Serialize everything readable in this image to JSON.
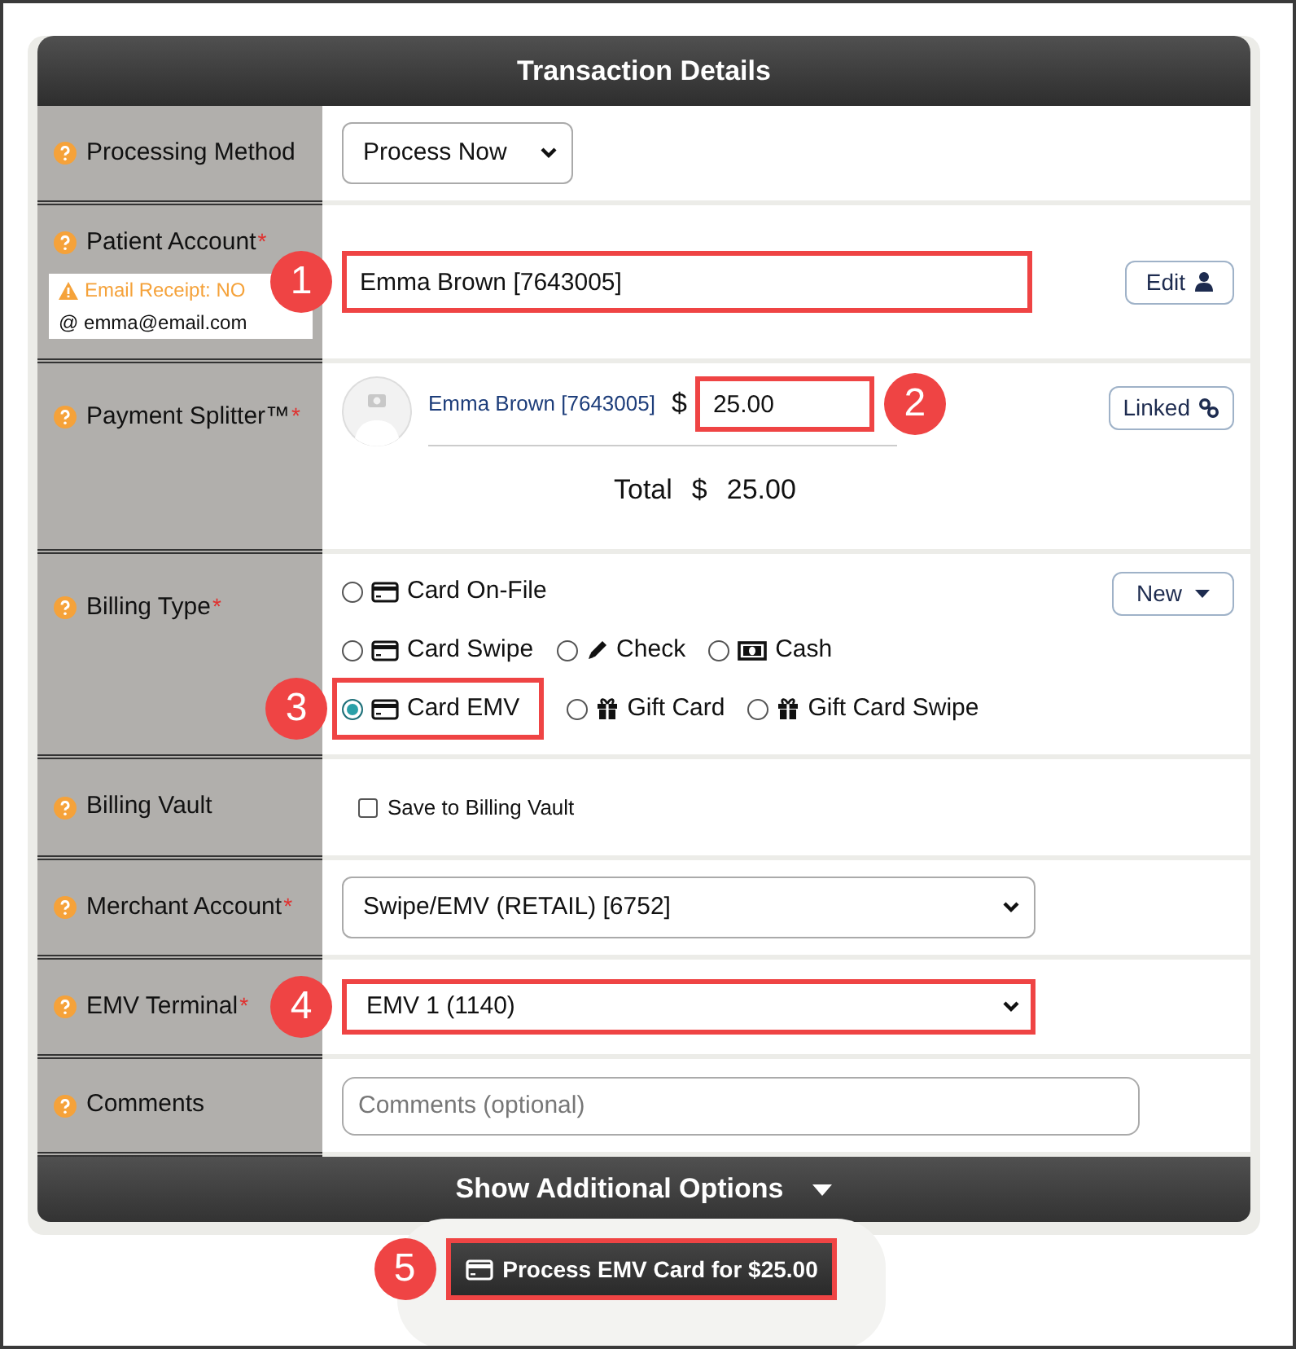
{
  "panel_title": "Transaction Details",
  "rows": [
    {
      "kind": "compact_select",
      "label": "Processing Method",
      "value": "Process Now"
    },
    {
      "kind": "patient",
      "label": "Patient Account",
      "required_mark": "*",
      "email_receipt": "Email Receipt: NO",
      "email": "@ emma@email.com",
      "value": "Emma Brown [7643005]",
      "callout": "1",
      "button": "Edit"
    },
    {
      "kind": "splitter",
      "label": "Payment Splitter™",
      "required_mark": "*",
      "account": "Emma Brown [7643005]",
      "currency": "$",
      "amount": "25.00",
      "callout": "2",
      "button": "Linked",
      "total_label": "Total",
      "total_currency": "$",
      "total": "25.00"
    },
    {
      "kind": "billing",
      "label": "Billing Type",
      "required_mark": "*",
      "button": "New",
      "options": [
        [
          {
            "label": "Card On-File",
            "kind": "card",
            "selected": false
          }
        ],
        [
          {
            "label": "Card Swipe",
            "kind": "card",
            "selected": false
          },
          {
            "label": "Check",
            "kind": "check",
            "selected": false
          },
          {
            "label": "Cash",
            "kind": "cash",
            "selected": false
          }
        ],
        [
          {
            "label": "Card EMV",
            "kind": "card",
            "selected": true,
            "callout": "3"
          },
          {
            "label": "Gift Card",
            "kind": "gift",
            "selected": false
          },
          {
            "label": "Gift Card Swipe",
            "kind": "gift",
            "selected": false
          }
        ]
      ]
    },
    {
      "kind": "checkbox",
      "label": "Billing Vault",
      "text": "Save to Billing Vault",
      "checked": false
    },
    {
      "kind": "select",
      "label": "Merchant Account",
      "required_mark": "*",
      "value": "Swipe/EMV (RETAIL) [6752]"
    },
    {
      "kind": "select",
      "label": "EMV Terminal",
      "required_mark": "*",
      "value": "EMV 1 (1140)",
      "callout": "4"
    },
    {
      "kind": "text",
      "label": "Comments",
      "placeholder": "Comments (optional)"
    }
  ],
  "footer_bar": "Show Additional Options",
  "submit": {
    "label": "Process EMV Card for $25.00",
    "callout": "5"
  }
}
